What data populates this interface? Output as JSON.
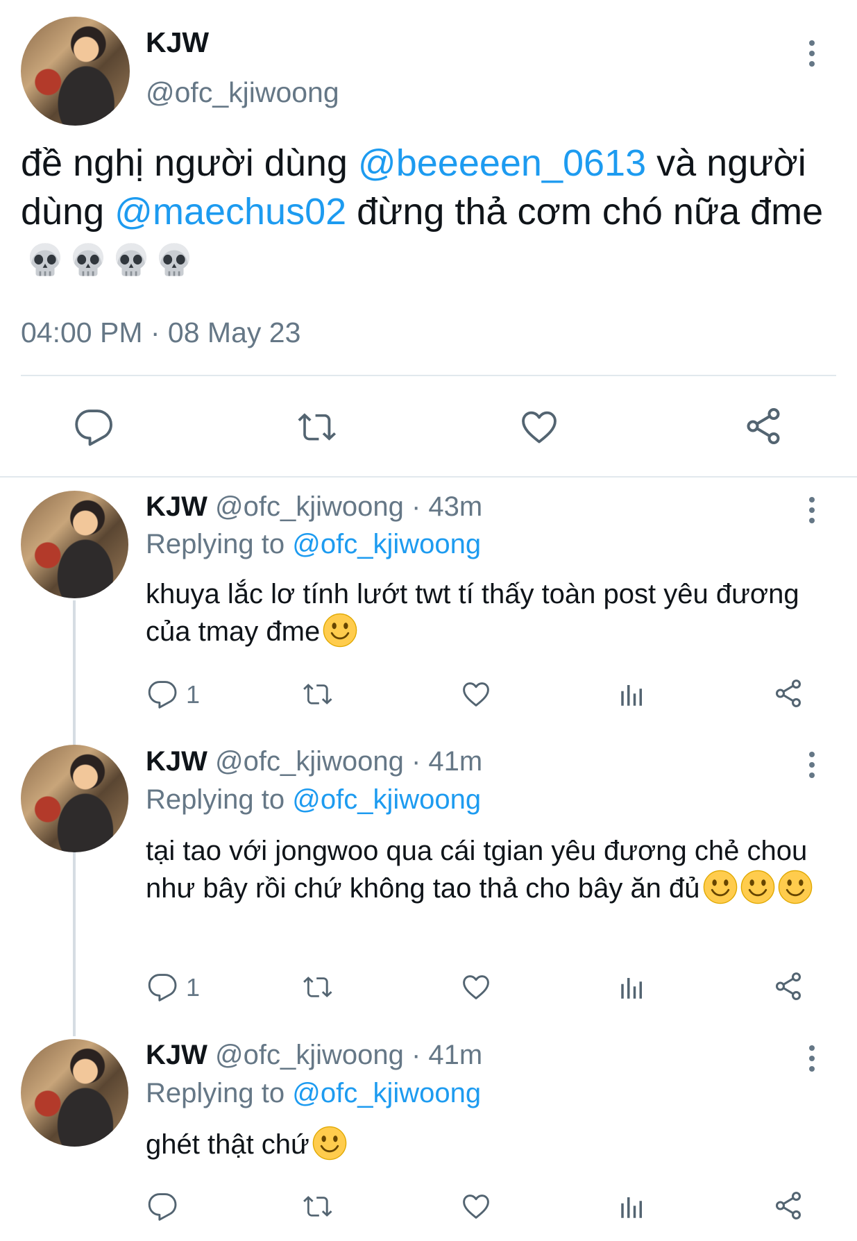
{
  "main_tweet": {
    "name": "KJW",
    "handle": "@ofc_kjiwoong",
    "text_parts": [
      "đề nghị người dùng ",
      "@beeeeen_0613",
      " và người dùng ",
      "@maechus02",
      " đừng thả cơm chó nữa đme"
    ],
    "emoji": "skull x4",
    "timestamp": "04:00 PM · 08 May 23",
    "actions": [
      "reply-icon",
      "retweet-icon",
      "like-icon",
      "share-icon"
    ]
  },
  "replies": [
    {
      "name": "KJW",
      "handle_time": "@ofc_kjiwoong · 43m",
      "replying_prefix": "Replying to ",
      "replying_handle": "@ofc_kjiwoong",
      "text": "khuya lắc lơ tính lướt twt tí thấy toàn post yêu đương của tmay đme",
      "emoji": "slightly-smiling-face x1",
      "reply_count": "1"
    },
    {
      "name": "KJW",
      "handle_time": "@ofc_kjiwoong · 41m",
      "replying_prefix": "Replying to ",
      "replying_handle": "@ofc_kjiwoong",
      "text": "tại tao với jongwoo qua cái tgian yêu đương chẻ chou như bây rồi chứ không tao thả cho bây ăn đủ",
      "emoji": "slightly-smiling-face x3",
      "reply_count": "1"
    },
    {
      "name": "KJW",
      "handle_time": "@ofc_kjiwoong · 41m",
      "replying_prefix": "Replying to ",
      "replying_handle": "@ofc_kjiwoong",
      "text": "ghét thật chứ",
      "emoji": "slightly-smiling-face x1",
      "reply_count": ""
    }
  ],
  "colors": {
    "accent": "#1d9bf0",
    "secondary_text": "#657786",
    "divider": "#e1e8ed"
  }
}
